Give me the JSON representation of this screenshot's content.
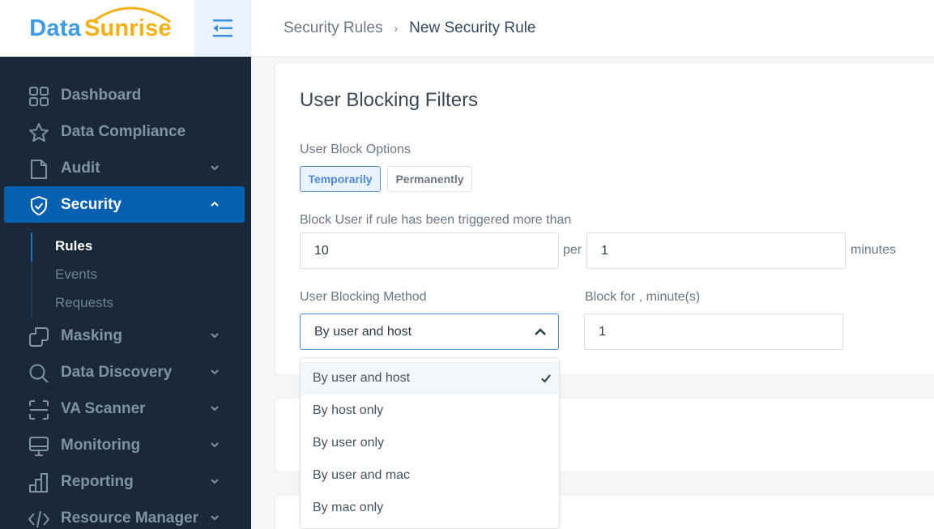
{
  "app": {
    "logo_part1": "Data",
    "logo_part2": "Sunrise",
    "brand_colors": {
      "data": "#3d9be9",
      "sunrise": "#f5b015",
      "sidebar_bg": "#192939",
      "active_nav": "#0560b0"
    }
  },
  "header": {
    "breadcrumb": [
      {
        "label": "Security Rules"
      },
      {
        "label": "New Security Rule"
      }
    ],
    "separator": "›"
  },
  "sidebar": {
    "items": [
      {
        "label": "Dashboard",
        "icon": "grid-icon",
        "expandable": false
      },
      {
        "label": "Data Compliance",
        "icon": "star-icon",
        "expandable": false
      },
      {
        "label": "Audit",
        "icon": "document-icon",
        "expandable": true
      },
      {
        "label": "Security",
        "icon": "shield-check-icon",
        "expandable": true,
        "active": true,
        "expanded": true
      },
      {
        "label": "Masking",
        "icon": "masking-icon",
        "expandable": true
      },
      {
        "label": "Data Discovery",
        "icon": "search-icon",
        "expandable": true
      },
      {
        "label": "VA Scanner",
        "icon": "scanner-icon",
        "expandable": true
      },
      {
        "label": "Monitoring",
        "icon": "monitor-icon",
        "expandable": true
      },
      {
        "label": "Reporting",
        "icon": "bar-chart-icon",
        "expandable": true
      },
      {
        "label": "Resource Manager",
        "icon": "code-icon",
        "expandable": true
      }
    ],
    "security_subitems": [
      {
        "label": "Rules",
        "active": true
      },
      {
        "label": "Events"
      },
      {
        "label": "Requests"
      }
    ]
  },
  "main": {
    "section_title": "User Blocking Filters",
    "block_options": {
      "label": "User Block Options",
      "options": [
        "Temporarily",
        "Permanently"
      ],
      "selected": "Temporarily"
    },
    "trigger": {
      "label": "Block User if rule has been triggered more than",
      "count_value": "10",
      "per_label": "per",
      "period_value": "1",
      "unit_label": "minutes"
    },
    "method": {
      "label": "User Blocking Method",
      "value": "By user and host",
      "options": [
        "By user and host",
        "By host only",
        "By user only",
        "By user and mac",
        "By mac only"
      ]
    },
    "block_for": {
      "label": "Block for , minute(s)",
      "value": "1"
    }
  }
}
